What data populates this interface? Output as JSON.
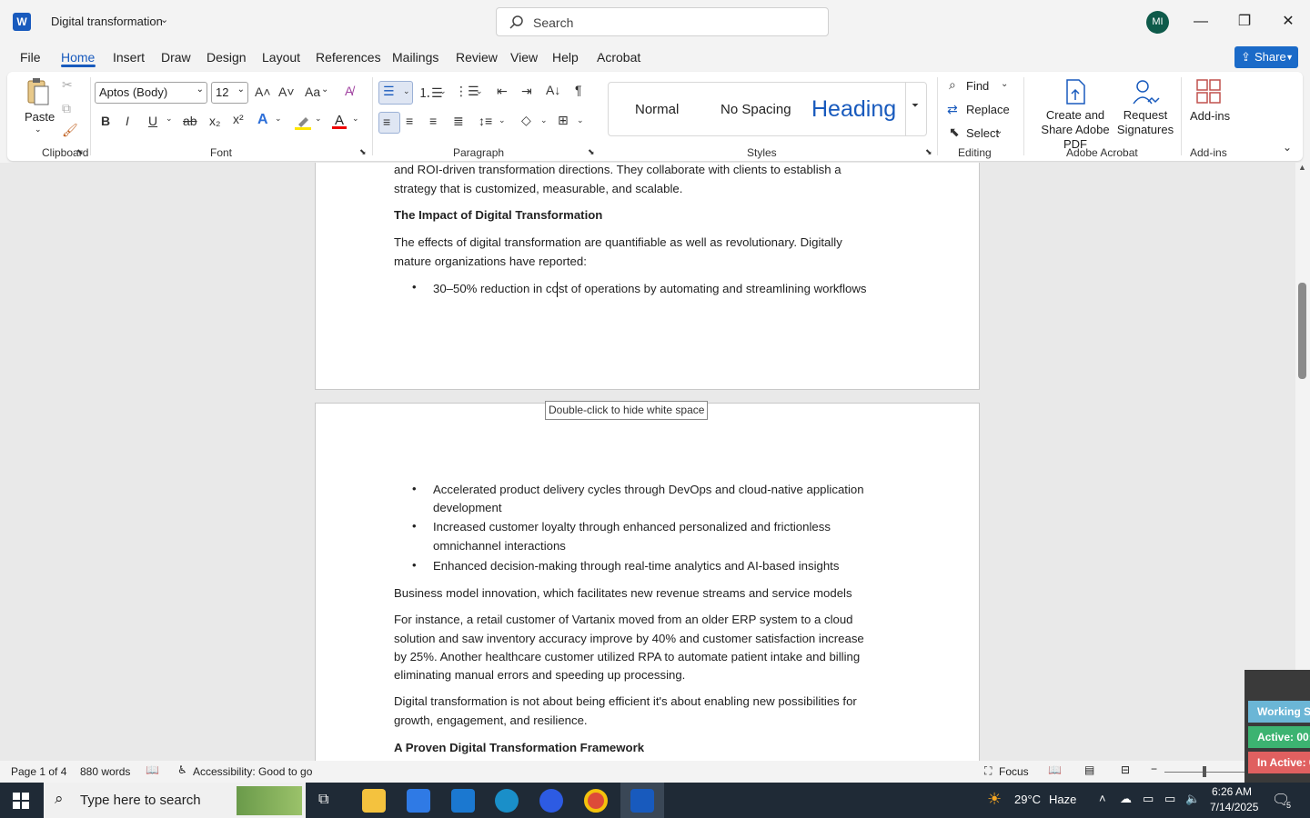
{
  "titlebar": {
    "app_logo": "W",
    "doc_title": "Digital transformation",
    "search_placeholder": "Search",
    "avatar_initials": "MI"
  },
  "tabs": [
    "File",
    "Home",
    "Insert",
    "Draw",
    "Design",
    "Layout",
    "References",
    "Mailings",
    "Review",
    "View",
    "Help",
    "Acrobat"
  ],
  "active_tab": "Home",
  "share_label": "Share",
  "ribbon": {
    "clipboard": {
      "paste_label": "Paste",
      "group_label": "Clipboard"
    },
    "font": {
      "font_name": "Aptos (Body)",
      "font_size": "12",
      "group_label": "Font",
      "bold": "B",
      "italic": "I",
      "underline": "U",
      "strike": "ab",
      "change_case": "Aa"
    },
    "paragraph": {
      "group_label": "Paragraph"
    },
    "styles": {
      "items": [
        "Normal",
        "No Spacing",
        "Heading"
      ],
      "group_label": "Styles"
    },
    "editing": {
      "find": "Find",
      "replace": "Replace",
      "select": "Select",
      "group_label": "Editing"
    },
    "acrobat": {
      "create_share": "Create and Share Adobe PDF",
      "request_sig": "Request Signatures",
      "group_label": "Adobe Acrobat"
    },
    "addins": {
      "label": "Add-ins",
      "group_label": "Add-ins"
    }
  },
  "document": {
    "page1": {
      "p_intro_line1": "and ROI-driven transformation directions. They collaborate with clients to establish a",
      "p_intro_line2": "strategy that is customized, measurable, and scalable.",
      "heading1": "The Impact of Digital Transformation",
      "p_effects_line1": "The effects of digital transformation are quantifiable as well as revolutionary. Digitally",
      "p_effects_line2": "mature organizations have reported:",
      "bullet1": "30–50% reduction in cost of operations by automating and streamlining workflows"
    },
    "tooltip": "Double-click to hide white space",
    "page2": {
      "bullets": [
        {
          "l1": "Accelerated product delivery cycles through DevOps and cloud-native application",
          "l2": "development"
        },
        {
          "l1": "Increased customer loyalty through enhanced personalized and frictionless",
          "l2": "omnichannel interactions"
        },
        {
          "l1": "Enhanced decision-making through real-time analytics and AI-based insights",
          "l2": ""
        }
      ],
      "p_business": "Business model innovation, which facilitates new revenue streams and service models",
      "p_instance": [
        "For instance, a retail customer of Vartanix moved from an older ERP system to a cloud",
        "solution and saw inventory accuracy improve by 40% and customer satisfaction increase",
        "by 25%. Another healthcare customer utilized RPA to automate patient intake and billing",
        "eliminating manual errors and speeding up processing."
      ],
      "p_digital": [
        "Digital transformation is not about being efficient it's about enabling new possibilities for",
        "growth, engagement, and resilience."
      ],
      "heading2": "A Proven Digital Transformation Framework"
    }
  },
  "statusbar": {
    "page": "Page 1 of 4",
    "words": "880 words",
    "accessibility": "Accessibility: Good to go",
    "focus": "Focus"
  },
  "widget": {
    "working": "Working S",
    "active": "Active: 00:",
    "inactive": "In Active: 0"
  },
  "taskbar": {
    "search_text": "Type here to search",
    "weather_temp": "29°C",
    "weather_desc": "Haze",
    "time": "6:26 AM",
    "date": "7/14/2025",
    "notif_count": "5"
  },
  "colors": {
    "accent": "#185abd",
    "share": "#1a6ac8",
    "active_green": "#3cb371",
    "inactive_red": "#e06060",
    "working_blue": "#6bb6d6"
  }
}
